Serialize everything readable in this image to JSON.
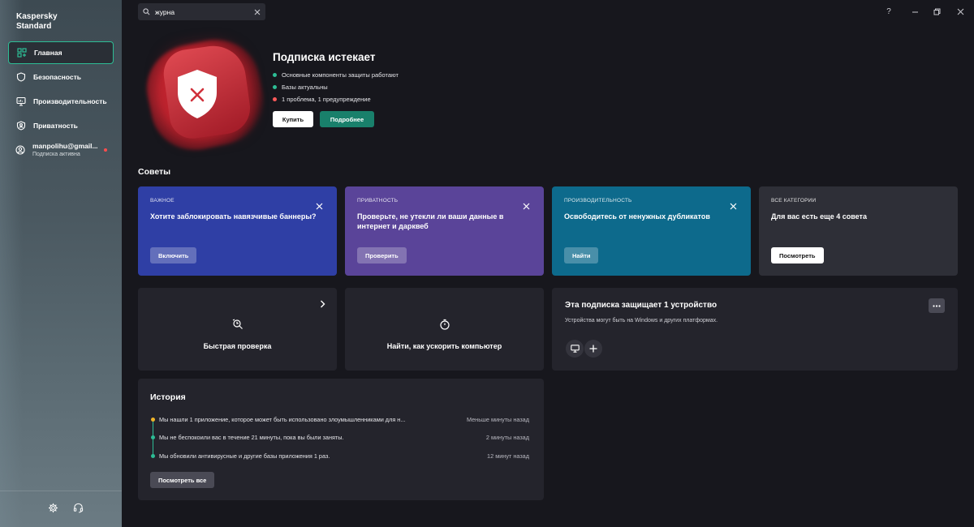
{
  "app": {
    "brand_line1": "Kaspersky",
    "brand_line2": "Standard"
  },
  "search": {
    "value": "журна",
    "clear_icon": "close-icon"
  },
  "window": {
    "help": "?",
    "minimize_icon": "minimize-icon",
    "maximize_icon": "restore-icon",
    "close_icon": "close-icon"
  },
  "sidebar": {
    "items": [
      {
        "label": "Главная",
        "icon": "home-icon",
        "active": true
      },
      {
        "label": "Безопасность",
        "icon": "shield-icon"
      },
      {
        "label": "Производительность",
        "icon": "monitor-icon"
      },
      {
        "label": "Приватность",
        "icon": "privacy-icon"
      }
    ],
    "account": {
      "email": "manpolihu@gmail...",
      "status": "Подписка активна"
    },
    "bottom": {
      "settings_icon": "gear-icon",
      "support_icon": "headset-icon"
    }
  },
  "hero": {
    "title": "Подписка истекает",
    "statuses": [
      {
        "text": "Основные компоненты защиты работают",
        "color": "#2dbd95"
      },
      {
        "text": "Базы актуальны",
        "color": "#2dbd95"
      },
      {
        "text": "1 проблема, 1 предупреждение",
        "color": "#ff5a5a"
      }
    ],
    "buy_label": "Купить",
    "details_label": "Подробнее"
  },
  "tips": {
    "title": "Советы",
    "cards": [
      {
        "category": "ВАЖНОЕ",
        "text": "Хотите заблокировать навязчивые баннеры?",
        "button": "Включить",
        "color": "#2f3fa5"
      },
      {
        "category": "ПРИВАТНОСТЬ",
        "text": "Проверьте, не утекли ли ваши данные в интернет и дарквеб",
        "button": "Проверить",
        "color": "#5a4499"
      },
      {
        "category": "ПРОИЗВОДИТЕЛЬНОСТЬ",
        "text": "Освободитесь от ненужных дубликатов",
        "button": "Найти",
        "color": "#0d6a8c"
      },
      {
        "category": "ВСЕ КАТЕГОРИИ",
        "text": "Для вас есть еще 4 совета",
        "button": "Посмотреть",
        "color": "#2e2f37"
      }
    ]
  },
  "actions": {
    "quick_scan": "Быстрая проверка",
    "speed_up": "Найти, как ускорить компьютер"
  },
  "subscription": {
    "title": "Эта подписка защищает 1 устройство",
    "desc": "Устройства могут быть на Windows и других платформах."
  },
  "history": {
    "title": "История",
    "rows": [
      {
        "text": "Мы нашли 1 приложение, которое может быть использовано злоумышленниками для н...",
        "time": "Меньше минуты назад",
        "color": "#f0b429"
      },
      {
        "text": "Мы не беспокоили вас в течение 21 минуты, пока вы были заняты.",
        "time": "2 минуты назад",
        "color": "#2dbd95"
      },
      {
        "text": "Мы обновили антивирусные и другие базы приложения 1 раз.",
        "time": "12 минут назад",
        "color": "#2dbd95"
      }
    ],
    "view_all": "Посмотреть все"
  }
}
